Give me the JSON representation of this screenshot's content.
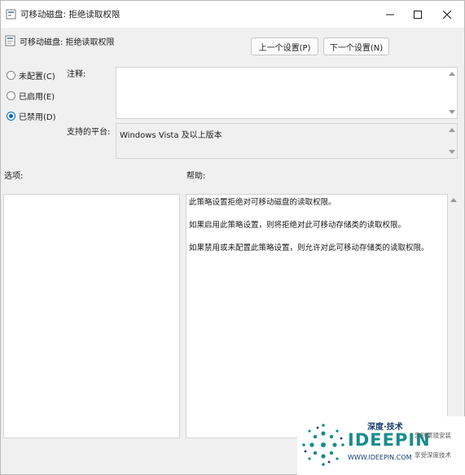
{
  "window": {
    "title": "可移动磁盘: 拒绝读取权限",
    "controls": {
      "minimize_icon": "minimize-icon",
      "maximize_icon": "maximize-icon",
      "close_icon": "close-icon"
    }
  },
  "header": {
    "policy_title": "可移动磁盘: 拒绝读取权限",
    "prev_button": "上一个设置(P)",
    "next_button": "下一个设置(N)"
  },
  "state": {
    "options": [
      {
        "label": "未配置(C)",
        "checked": false
      },
      {
        "label": "已启用(E)",
        "checked": false
      },
      {
        "label": "已禁用(D)",
        "checked": true
      }
    ]
  },
  "comment": {
    "label": "注释:",
    "value": ""
  },
  "platform": {
    "label": "支持的平台:",
    "value": "Windows Vista 及以上版本"
  },
  "options_section": {
    "label": "选项:"
  },
  "help_section": {
    "label": "帮助:",
    "paragraphs": [
      "此策略设置拒绝对可移动磁盘的读取权限。",
      "如果启用此策略设置，则将拒绝对此可移动存储类的读取权限。",
      "如果禁用或未配置此策略设置，则允许对此可移动存储类的读取权限。"
    ]
  },
  "watermark": {
    "brand_cn": "深度·技术",
    "brand_en": "IDEEPIN",
    "url": "WWW.IDEEPIN.COM",
    "slogan1": "告别繁琐安装",
    "slogan2": "享受深度技术"
  },
  "colors": {
    "accent": "#0067c0",
    "brand_teal": "#1a8c8c",
    "brand_dark": "#143c6e"
  }
}
